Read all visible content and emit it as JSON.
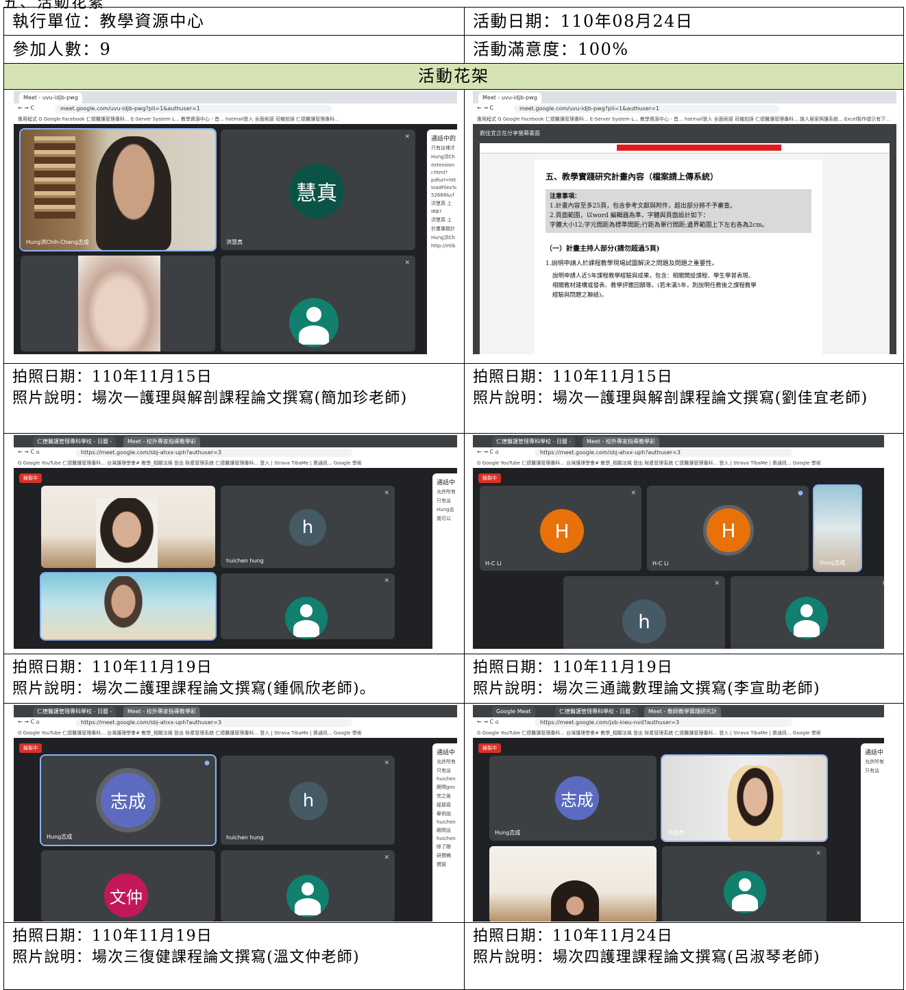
{
  "top_title": "五、活動花絮",
  "info": {
    "unit_label": "執行單位：教學資源中心",
    "date_label": "活動日期：110年08月24日",
    "count_label": "參加人數：9",
    "satisfaction_label": "活動滿意度：100%"
  },
  "gallery_header": "活動花架",
  "photos": [
    {
      "date": "拍照日期：110年11月15日",
      "desc": "照片說明：場次一護理與解剖課程論文撰寫(簡加珍老師)",
      "shot": {
        "tab": "Meet - uvu-idjb-pwg",
        "url": "meet.google.com/uvu-idjb-pwg?pli=1&authuser=1",
        "bookmarks": "應用程式  G Google  Facebook  仁德醫護管理專科...  E-Server System L...  教學資源中心 - 首...  hotmail登入  全面術語  司機拍誤  仁德醫護管理專科...",
        "tiles": [
          "Hung洪Chih-Cheng志成",
          "洪慧真"
        ],
        "avatar_text": "慧真",
        "panel_title": "通話中的",
        "panel_lines": [
          "只有這裡才",
          "Hung洪Ch",
          "extension",
          "r.html?",
          "pdfurl=htt",
          "loadFiles%",
          "52668&cf",
          "洪慧真 上",
          "IRB?",
          "洪慧真 上",
          "計畫專題計",
          "Hung洪Ch",
          "http://irtib"
        ]
      }
    },
    {
      "date": "拍照日期：110年11月15日",
      "desc": "照片說明：場次一護理與解剖課程論文撰寫(劉佳宜老師)",
      "shot": {
        "tab": "Meet - uvu-idjb-pwg",
        "url": "meet.google.com/uvu-idjb-pwg?pli=1&authuser=1",
        "bookmarks": "應用程式  G Google  Facebook  仁德醫護管理專科...  E-Server System L...  教學資源中心 - 首...  hotmail登入  全面術語  司機拍誤  仁德醫護管理專科...  誰人居家照護系統...  Excel製作提示有下...",
        "presenter": "劉佳宜正在分享螢幕畫面",
        "doc_heading": "五、教學實踐研究計畫內容（檔案請上傳系統）",
        "doc_notes_title": "注意事項：",
        "doc_notes": [
          "1.計畫內容至多25頁，包含參考文獻與附件，超出部分將不予審查。",
          "2.頁面範圍，以word 編輯器為準，字體與頁面設計如下：",
          "字體大小12;字元間距為標準間距;行距為單行間距;邊界範圍上下左右各為2cm。"
        ],
        "doc_section": "（一）計畫主持人部分(請勿超過5頁)",
        "doc_item": "1.說明申請人於課程教學現場試圖解決之問題及問題之重要性。",
        "doc_body": [
          "說明申請人近5年課程教學經驗與成果，包含：相關開設課程、學生學習表現、",
          "相關教材建構或發表、教學評鑑回饋等。(若未滿5年，則說明任教後之課程教學",
          "經驗與問題之聯結)。"
        ]
      }
    },
    {
      "date": "拍照日期：110年11月19日",
      "desc": "照片說明：場次二護理課程論文撰寫(鍾佩欣老師)。",
      "shot": {
        "tab1": "仁德醫護管理專科學校 - 日曆 -",
        "tab2": "Meet - 校外專家指導教學彩",
        "url": "https://meet.google.com/sbj-ahxx-uph?authuser=3",
        "bookmarks": "G Google  YouTube  仁德醫護管理專科...  台灣護理學會#  教學_相關法規  登出  財產管理系統  仁德醫護管理專科...  登入 | Strava  TibaMe | 資通訊...  Google 學術",
        "rec": "錄製中",
        "tiles": [
          "",
          "huichen hung"
        ],
        "avatar_text": "h",
        "panel_title": "通話中",
        "panel_lines": [
          "允許所有",
          "只有這",
          "Hung志",
          "我可以"
        ]
      }
    },
    {
      "date": "拍照日期：110年11月19日",
      "desc": "照片說明：場次三通識數理論文撰寫(李宣助老師)",
      "shot": {
        "url": "https://meet.google.com/sbj-ahxx-uph?authuser=3",
        "bookmarks": "G Google  YouTube  仁德醫護管理專科...  台灣護理學會#  教學_相關法規  登出  財產管理系統  仁德醫護管理專科...  登入 | Strava  TibaMe | 資通訊...  Google 學術",
        "rec": "錄製中",
        "tiles": [
          "H-C Li",
          "H-C Li",
          "Hung志成"
        ],
        "avatar_H": "H",
        "avatar_h": "h"
      }
    },
    {
      "date": "拍照日期：110年11月19日",
      "desc": "照片說明：場次三復健課程論文撰寫(溫文仲老師)",
      "shot": {
        "tab1": "仁德醫護管理專科學校 - 日曆 -",
        "tab2": "Meet - 校外專家指導教學彩",
        "url": "https://meet.google.com/sbj-ahxx-uph?authuser=3",
        "bookmarks": "G Google  YouTube  仁德醫護管理專科...  台灣護理學會#  教學_相關法規  登出  財產管理系統  仁德醫護管理專科...  登入 | Strava  TibaMe | 資通訊...  Google 學術",
        "rec": "錄製中",
        "tiles": [
          "Hung志成",
          "huichen hung"
        ],
        "avatar1": "志成",
        "avatar2": "h",
        "avatar3": "文仲",
        "panel_title": "通話中",
        "panel_lines": [
          "允許所有",
          "只有這",
          "huichen",
          "跟問goo",
          "完之後",
          "經那寫",
          "舉例說",
          "huichen",
          "跟問這",
          "huichen",
          "除了跟",
          "研撰稿",
          "撰寫"
        ]
      }
    },
    {
      "date": "拍照日期：110年11月24日",
      "desc": "照片說明：場次四護理課程論文撰寫(呂淑琴老師)",
      "shot": {
        "tab1": "Google Meet",
        "tab2": "仁德醫護管理專科學校 - 日曆 -",
        "tab3": "Meet - 教師教學實踐研究計",
        "url": "https://meet.google.com/jxb-ineu-nvd?authuser=3",
        "bookmarks": "G Google  YouTube  仁德醫護管理專科...  台灣護理學會#  教學_相關法規  登出  財產管理系統  仁德醫護管理專科...  登入 | Strava  TibaMe | 資通訊...  Google 學術",
        "rec": "錄製中",
        "tiles": [
          "Hung志成",
          "洪慧真"
        ],
        "avatar_text": "志成",
        "panel_title": "通話中",
        "panel_lines": [
          "允許所有",
          "只有這"
        ]
      }
    }
  ]
}
